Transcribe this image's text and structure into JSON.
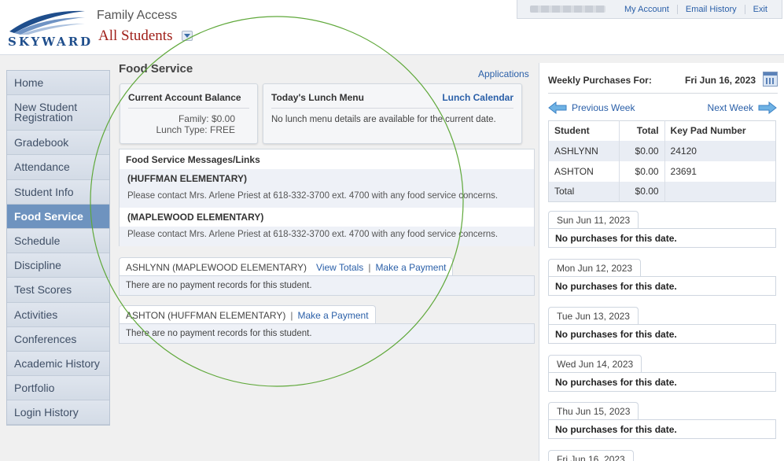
{
  "header": {
    "logo_text": "SKYWARD",
    "app_name": "Family Access",
    "student_selector": "All Students",
    "links": [
      "My Account",
      "Email History",
      "Exit"
    ]
  },
  "sidebar": {
    "items": [
      {
        "label": "Home"
      },
      {
        "label": "New Student Registration"
      },
      {
        "label": "Gradebook"
      },
      {
        "label": "Attendance"
      },
      {
        "label": "Student Info"
      },
      {
        "label": "Food Service"
      },
      {
        "label": "Schedule"
      },
      {
        "label": "Discipline"
      },
      {
        "label": "Test Scores"
      },
      {
        "label": "Activities"
      },
      {
        "label": "Conferences"
      },
      {
        "label": "Academic History"
      },
      {
        "label": "Portfolio"
      },
      {
        "label": "Login History"
      }
    ],
    "active": "Food Service"
  },
  "main": {
    "title": "Food Service",
    "applications_link": "Applications",
    "balance": {
      "title": "Current Account Balance",
      "family_label": "Family:",
      "family_value": "$0.00",
      "lunch_type_label": "Lunch Type:",
      "lunch_type_value": "FREE"
    },
    "lunch_menu": {
      "title": "Today's Lunch Menu",
      "calendar_link": "Lunch Calendar",
      "text": "No lunch menu details are available for the current date."
    },
    "messages": {
      "title": "Food Service Messages/Links",
      "entries": [
        {
          "school": "(HUFFMAN ELEMENTARY)",
          "text": "Please contact Mrs. Arlene Priest at 618-332-3700 ext. 4700 with any food service concerns."
        },
        {
          "school": "(MAPLEWOOD ELEMENTARY)",
          "text": "Please contact Mrs. Arlene Priest at 618-332-3700 ext. 4700 with any food service concerns."
        }
      ]
    },
    "students": [
      {
        "label": "ASHLYNN (MAPLEWOOD ELEMENTARY)",
        "view_totals": "View Totals",
        "make_payment": "Make a Payment",
        "no_records": "There are no payment records for this student."
      },
      {
        "label": "ASHTON (HUFFMAN ELEMENTARY)",
        "make_payment": "Make a Payment",
        "no_records": "There are no payment records for this student."
      }
    ]
  },
  "weekly": {
    "title": "Weekly Purchases For:",
    "date": "Fri Jun 16, 2023",
    "prev_week": "Previous Week",
    "next_week": "Next Week",
    "columns": [
      "Student",
      "Total",
      "Key Pad Number"
    ],
    "rows": [
      {
        "student": "ASHLYNN",
        "total": "$0.00",
        "keypad": "24120"
      },
      {
        "student": "ASHTON",
        "total": "$0.00",
        "keypad": "23691"
      },
      {
        "student": "Total",
        "total": "$0.00",
        "keypad": ""
      }
    ],
    "days": [
      {
        "date": "Sun Jun 11, 2023",
        "text": "No purchases for this date."
      },
      {
        "date": "Mon Jun 12, 2023",
        "text": "No purchases for this date."
      },
      {
        "date": "Tue Jun 13, 2023",
        "text": "No purchases for this date."
      },
      {
        "date": "Wed Jun 14, 2023",
        "text": "No purchases for this date."
      },
      {
        "date": "Thu Jun 15, 2023",
        "text": "No purchases for this date."
      },
      {
        "date": "Fri Jun 16, 2023",
        "text": ""
      }
    ]
  },
  "colors": {
    "brand_blue": "#1f4e8c",
    "link": "#2a5fa8",
    "active_nav": "#6e93bf",
    "student_selector": "#a0201a",
    "annotation_circle": "#5fa83a"
  }
}
